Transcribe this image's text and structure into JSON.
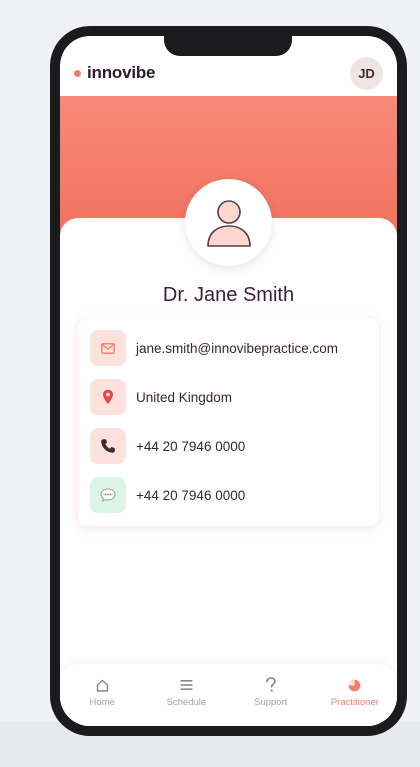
{
  "app": {
    "brand": "innovibe",
    "user_initials": "JD"
  },
  "profile": {
    "name": "Dr. Jane Smith"
  },
  "contacts": [
    {
      "icon": "envelope-icon",
      "value": "jane.smith@innovibepractice.com"
    },
    {
      "icon": "location-pin-icon",
      "value": "United Kingdom"
    },
    {
      "icon": "phone-icon",
      "value": "+44 20 7946 0000"
    },
    {
      "icon": "chat-bubble-icon",
      "value": "+44 20 7946 0000"
    }
  ],
  "tabs": [
    {
      "label": "Home",
      "icon": "home-icon"
    },
    {
      "label": "Schedule",
      "icon": "menu-lines-icon"
    },
    {
      "label": "Support",
      "icon": "question-icon"
    },
    {
      "label": "Practitioner",
      "icon": "pie-chart-icon",
      "active": true
    }
  ],
  "colors": {
    "accent": "#f07e68",
    "hero_top": "#f9897a",
    "hero_bottom": "#f06f5c",
    "text_dark": "#3a1f36"
  }
}
